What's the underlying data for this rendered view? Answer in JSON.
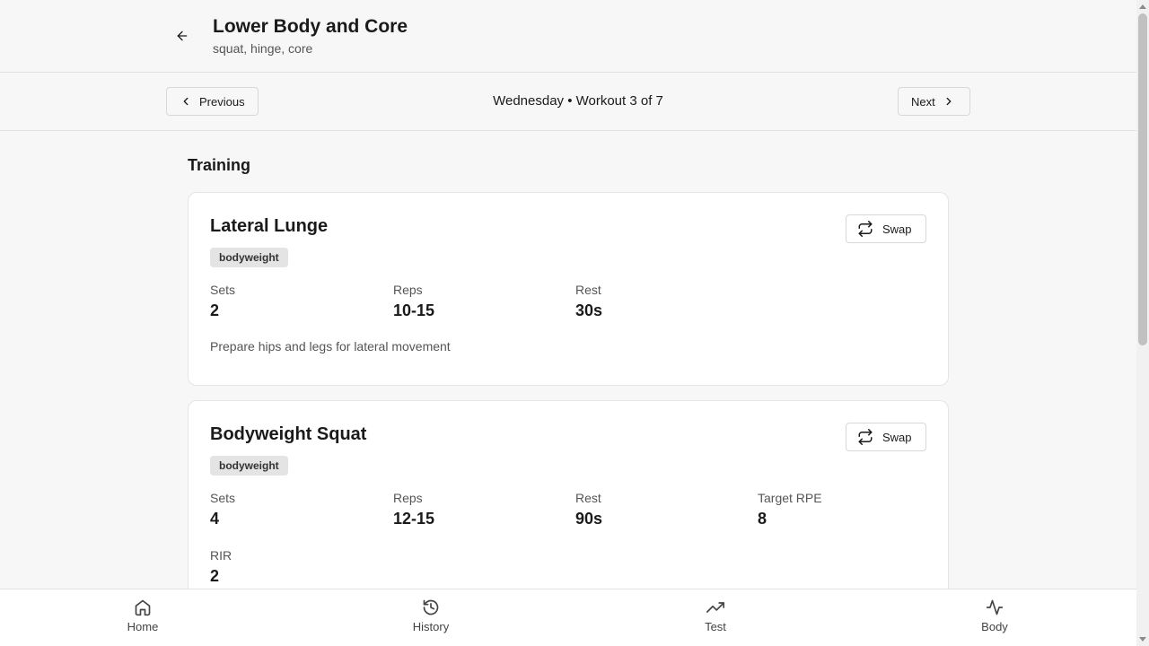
{
  "header": {
    "title": "Lower Body and Core",
    "subtitle": "squat, hinge, core"
  },
  "navbar": {
    "previous_label": "Previous",
    "next_label": "Next",
    "center_text": "Wednesday • Workout 3 of 7"
  },
  "section": {
    "title": "Training"
  },
  "exercises": [
    {
      "name": "Lateral Lunge",
      "tag": "bodyweight",
      "swap_label": "Swap",
      "stats": [
        {
          "label": "Sets",
          "value": "2"
        },
        {
          "label": "Reps",
          "value": "10-15"
        },
        {
          "label": "Rest",
          "value": "30s"
        }
      ],
      "note": "Prepare hips and legs for lateral movement"
    },
    {
      "name": "Bodyweight Squat",
      "tag": "bodyweight",
      "swap_label": "Swap",
      "stats": [
        {
          "label": "Sets",
          "value": "4"
        },
        {
          "label": "Reps",
          "value": "12-15"
        },
        {
          "label": "Rest",
          "value": "90s"
        },
        {
          "label": "Target RPE",
          "value": "8"
        },
        {
          "label": "RIR",
          "value": "2"
        }
      ]
    }
  ],
  "bottom_nav": [
    {
      "label": "Home",
      "icon": "home-icon"
    },
    {
      "label": "History",
      "icon": "history-icon"
    },
    {
      "label": "Test",
      "icon": "trending-up-icon"
    },
    {
      "label": "Body",
      "icon": "activity-icon"
    }
  ]
}
